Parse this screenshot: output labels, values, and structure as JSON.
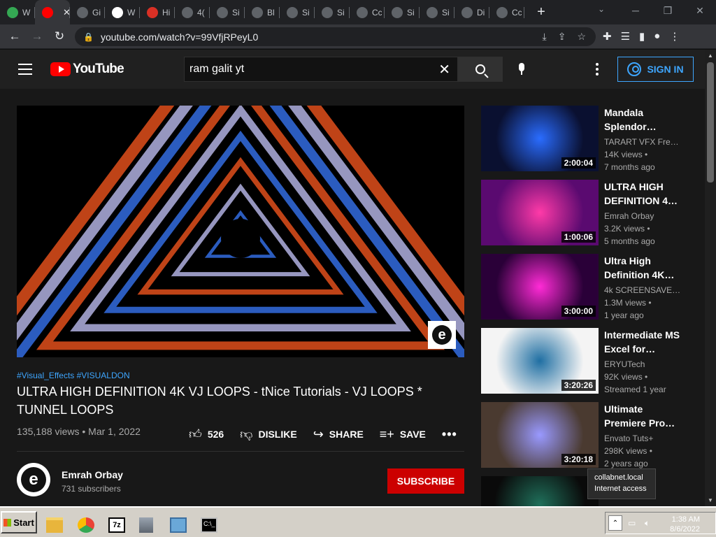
{
  "browser": {
    "tabs": [
      {
        "label": "W",
        "icon": "google-drive-icon",
        "color": "#34a853"
      },
      {
        "label": "",
        "icon": "youtube-icon",
        "color": "#ff0000",
        "active": true
      },
      {
        "label": "Gi",
        "icon": "globe-icon",
        "color": "#5f6368"
      },
      {
        "label": "W",
        "icon": "wordpress-icon",
        "color": "#ffffff"
      },
      {
        "label": "Hi",
        "icon": "red-app-icon",
        "color": "#d93025"
      },
      {
        "label": "4(",
        "icon": "globe-icon",
        "color": "#5f6368"
      },
      {
        "label": "Si",
        "icon": "globe-icon",
        "color": "#5f6368"
      },
      {
        "label": "Bl",
        "icon": "globe-icon",
        "color": "#5f6368"
      },
      {
        "label": "Si",
        "icon": "globe-icon",
        "color": "#5f6368"
      },
      {
        "label": "Si",
        "icon": "globe-icon",
        "color": "#5f6368"
      },
      {
        "label": "Cc",
        "icon": "puzzle-globe-icon",
        "color": "#5f6368"
      },
      {
        "label": "Si",
        "icon": "globe-icon",
        "color": "#5f6368"
      },
      {
        "label": "Si",
        "icon": "globe-icon",
        "color": "#5f6368"
      },
      {
        "label": "Di",
        "icon": "download-icon",
        "color": "#5f6368"
      },
      {
        "label": "Cc",
        "icon": "puzzle-globe-icon",
        "color": "#5f6368"
      }
    ],
    "url": "youtube.com/watch?v=99VfjRPeyL0"
  },
  "youtube": {
    "logo_text": "YouTube",
    "search_value": "ram galit yt",
    "signin_label": "SIGN IN"
  },
  "video": {
    "hashtags": "#Visual_Effects #VISUALDON",
    "title": "ULTRA HIGH DEFINITION 4K VJ LOOPS - tNice Tutorials - VJ LOOPS * TUNNEL LOOPS",
    "views_date": "135,188 views • Mar 1, 2022",
    "likes": "526",
    "dislike_label": "DISLIKE",
    "share_label": "SHARE",
    "save_label": "SAVE"
  },
  "channel": {
    "name": "Emrah Orbay",
    "subscribers": "731 subscribers",
    "subscribe_label": "SUBSCRIBE"
  },
  "recommendations": [
    {
      "title": "Mandala Splendor…",
      "channel": "TARART VFX Fre…",
      "views": "14K views •",
      "age": "7 months ago",
      "duration": "2:00:04",
      "colors": [
        "#0a1030",
        "#2a6cff"
      ]
    },
    {
      "title": "ULTRA HIGH DEFINITION 4…",
      "channel": "Emrah Orbay",
      "views": "3.2K views •",
      "age": "5 months ago",
      "duration": "1:00:06",
      "colors": [
        "#5a0a70",
        "#ff3aa8"
      ]
    },
    {
      "title": "Ultra High Definition 4K…",
      "channel": "4k SCREENSAVE…",
      "views": "1.3M views •",
      "age": "1 year ago",
      "duration": "3:00:00",
      "colors": [
        "#2a0038",
        "#ff2bd6"
      ]
    },
    {
      "title": "Intermediate MS Excel for…",
      "channel": "ERYUTech",
      "views": "92K views •",
      "age": "Streamed 1 year",
      "duration": "3:20:26",
      "colors": [
        "#f4f4f4",
        "#1f6fa3"
      ]
    },
    {
      "title": "Ultimate Premiere Pro…",
      "channel": "Envato Tuts+",
      "views": "298K views •",
      "age": "2 years ago",
      "duration": "3:20:18",
      "colors": [
        "#4a3a30",
        "#9999ff"
      ]
    }
  ],
  "tooltip": {
    "line1": "collabnet.local",
    "line2": "Internet access"
  },
  "taskbar": {
    "start_label": "Start",
    "time": "1:38 AM",
    "date": "8/6/2022"
  }
}
